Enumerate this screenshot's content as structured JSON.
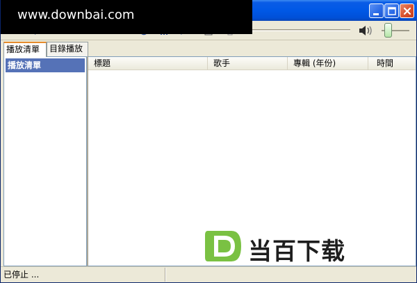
{
  "watermark": {
    "text": "www.downbai.com"
  },
  "titlebar": {
    "buttons": [
      {
        "name": "minimize-button",
        "icon": "minimize-icon"
      },
      {
        "name": "maximize-button",
        "icon": "maximize-icon"
      },
      {
        "name": "close-button",
        "icon": "close-icon"
      }
    ]
  },
  "toolbar": {
    "tools": [
      "menu-icon",
      "play-icon",
      "stop-icon",
      "previous-icon",
      "pause-icon",
      "next-icon",
      "repeat-icon",
      "equalizer-icon",
      "mute-icon",
      "edit-icon",
      "settings-icon"
    ],
    "volume_icon": "speaker-icon"
  },
  "tabs": [
    {
      "label": "播放清單",
      "active": true
    },
    {
      "label": "目錄播放",
      "active": false
    }
  ],
  "sidebar": {
    "items": [
      {
        "label": "播放清單",
        "selected": true
      }
    ]
  },
  "table": {
    "columns": [
      "標題",
      "歌手",
      "專輯 (年份)",
      "時間"
    ],
    "rows": []
  },
  "status": {
    "text": "已停止 ..."
  },
  "logo": {
    "text": "当百下载",
    "badge_letter": "D"
  },
  "colors": {
    "titlebar": "#0058e6",
    "selection": "#5572b7",
    "tab_accent": "#e68b2c",
    "logo_green": "#7ac143"
  }
}
